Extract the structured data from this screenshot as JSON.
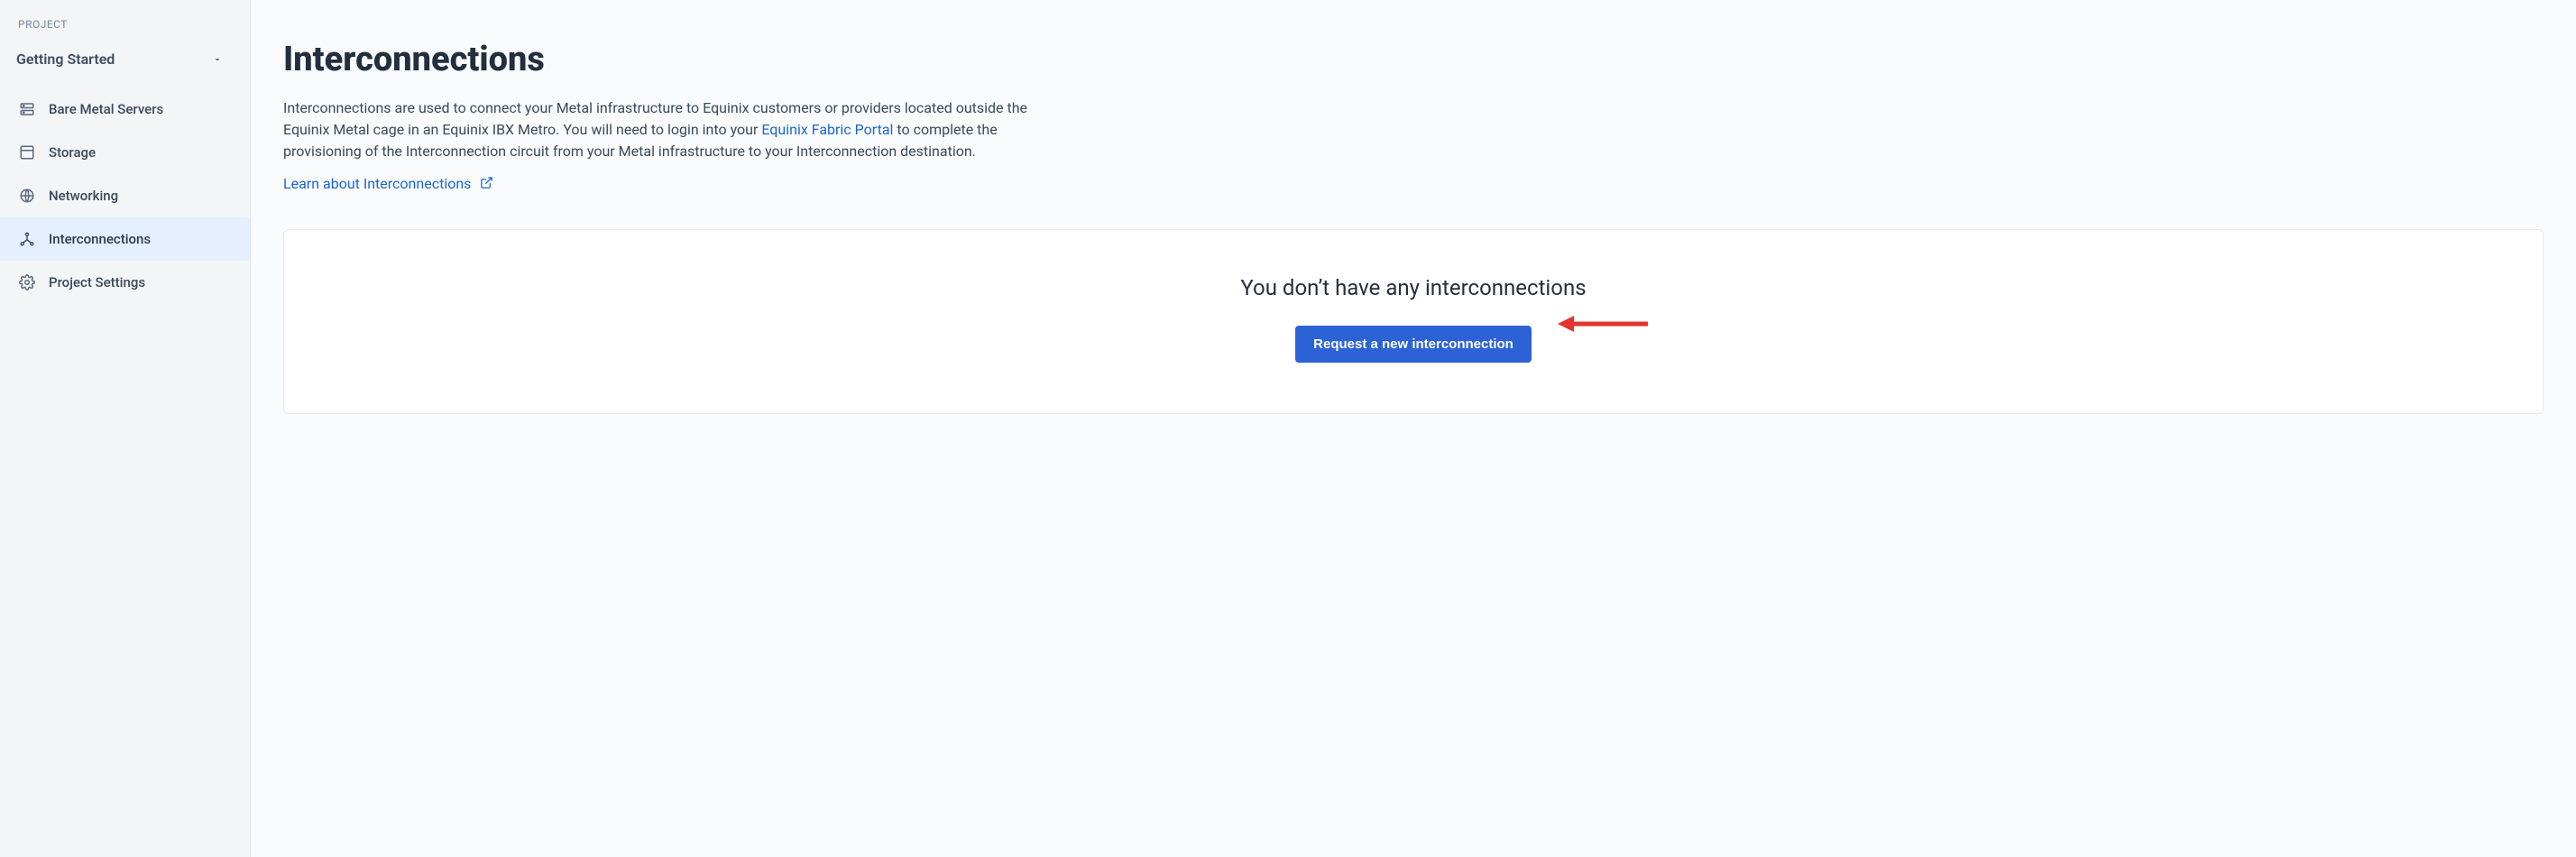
{
  "sidebar": {
    "header": "PROJECT",
    "project_selector_label": "Getting Started",
    "items": [
      {
        "label": "Bare Metal Servers",
        "icon": "server-icon"
      },
      {
        "label": "Storage",
        "icon": "storage-icon"
      },
      {
        "label": "Networking",
        "icon": "network-icon"
      },
      {
        "label": "Interconnections",
        "icon": "interconnections-icon"
      },
      {
        "label": "Project Settings",
        "icon": "gear-icon"
      }
    ],
    "active_index": 3
  },
  "main": {
    "title": "Interconnections",
    "description_prefix": "Interconnections are used to connect your Metal infrastructure to Equinix customers or providers located outside the Equinix Metal cage in an Equinix IBX Metro. You will need to login into your ",
    "description_link_text": "Equinix Fabric Portal",
    "description_suffix": " to complete the provisioning of the Interconnection circuit from your Metal infrastructure to your Interconnection destination.",
    "learn_link_text": "Learn about Interconnections",
    "empty_state": {
      "title": "You don’t have any interconnections",
      "button_label": "Request a new interconnection"
    }
  },
  "colors": {
    "primary": "#2d62d6",
    "link": "#1a66d6",
    "arrow": "#e3342f"
  }
}
